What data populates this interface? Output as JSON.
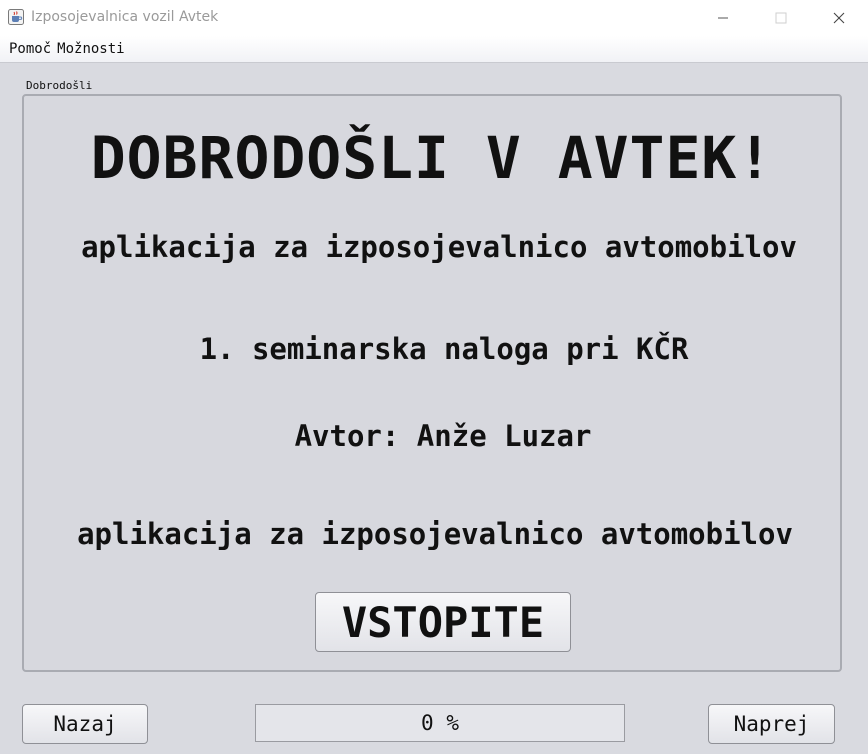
{
  "window": {
    "title": "Izposojevalnica vozil Avtek",
    "icon": "java-cup-icon"
  },
  "menu": {
    "items": [
      "Pomoč",
      "Možnosti"
    ]
  },
  "panel": {
    "label": "Dobrodošli",
    "title": "DOBRODOŠLI V AVTEK!",
    "subtitle": "aplikacija za izposojevalnico avtomobilov",
    "seminar": "1. seminarska naloga pri KČR",
    "author": "Avtor: Anže Luzar",
    "tagline": "aplikacija za izposojevalnico avtomobilov",
    "enter_label": "VSTOPITE"
  },
  "footer": {
    "back_label": "Nazaj",
    "next_label": "Naprej",
    "progress_value": 0,
    "progress_text": "0 %"
  }
}
